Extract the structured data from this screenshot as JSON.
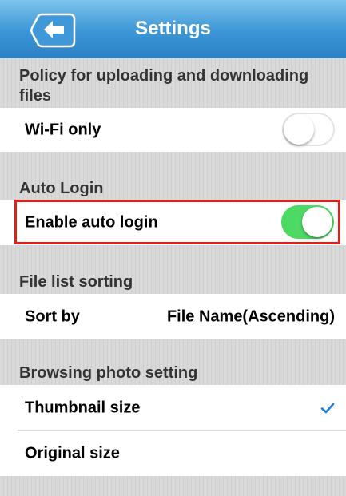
{
  "header": {
    "title": "Settings",
    "back_icon": "left-arrow-icon"
  },
  "sections": {
    "upload_policy": {
      "header": "Policy for uploading and downloading files",
      "wifi_only": {
        "label": "Wi-Fi only",
        "toggle": "off"
      }
    },
    "auto_login": {
      "header": "Auto Login",
      "enable_auto_login": {
        "label": "Enable auto login",
        "toggle": "on"
      }
    },
    "sorting": {
      "header": "File list sorting",
      "sort_by": {
        "label": "Sort by",
        "value": "File Name(Ascending)"
      }
    },
    "photo": {
      "header": "Browsing photo setting",
      "thumbnail": {
        "label": "Thumbnail size",
        "selected": true
      },
      "original": {
        "label": "Original size",
        "selected": false
      }
    }
  },
  "colors": {
    "nav_blue": "#3c96d6",
    "toggle_on": "#4cd964",
    "highlight_red": "#e0201b",
    "check_blue": "#1a7ee0"
  }
}
